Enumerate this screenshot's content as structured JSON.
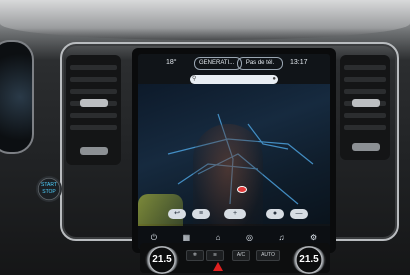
{
  "status_bar": {
    "temperature": "18°",
    "profile_pill": "GENERATI...",
    "phone_pill": "Pas de tél.",
    "time": "13:17"
  },
  "search": {
    "placeholder": ""
  },
  "nav_fabs": [
    "↩",
    "≡",
    "+",
    "●",
    "—"
  ],
  "bottom_bar": [
    "⏻",
    "▦",
    "⌂",
    "◎",
    "♫",
    "⚙"
  ],
  "climate": {
    "left_temp": "21.5",
    "right_temp": "21.5",
    "left_buttons": [
      "❄",
      "≋"
    ],
    "right_buttons": [
      "A/C",
      "AUTO"
    ],
    "hazard_color": "#e02020"
  },
  "start_button": "START\nSTOP"
}
